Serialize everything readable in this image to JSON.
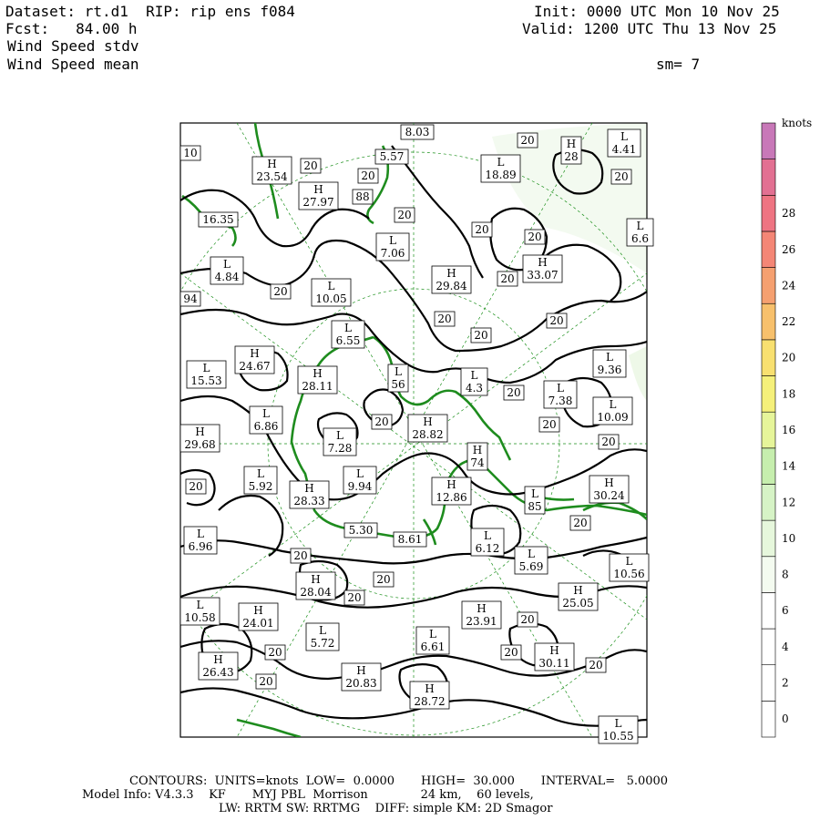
{
  "header": {
    "dataset": "Dataset: rt.d1  RIP: rip ens f084",
    "fcst": "Fcst:   84.00 h",
    "field_stdv": "Wind Speed stdv",
    "field_mean": "Wind Speed mean",
    "init": "Init: 0000 UTC Mon 10 Nov 25",
    "valid": "Valid: 1200 UTC Thu 13 Nov 25",
    "smooth": "sm= 7"
  },
  "colorbar": {
    "units": "knots",
    "labels": [
      "0",
      "2",
      "4",
      "6",
      "8",
      "10",
      "12",
      "14",
      "16",
      "18",
      "20",
      "22",
      "24",
      "26",
      "28"
    ],
    "colors": [
      "#ffffff",
      "#ffffff",
      "#ffffff",
      "#ffffff",
      "#f4fbf0",
      "#e6f7dc",
      "#d6f3c6",
      "#c6eeae",
      "#e6f59a",
      "#f5f07a",
      "#f8e070",
      "#f7c06c",
      "#f5a070",
      "#f48676",
      "#ee7482",
      "#e27092",
      "#c878b8"
    ]
  },
  "labels": [
    {
      "kind": "L",
      "value": "4.41"
    },
    {
      "kind": "H",
      "value": "28"
    },
    {
      "kind": "",
      "value": "20"
    },
    {
      "kind": "",
      "value": "20"
    },
    {
      "kind": "",
      "value": "8.03"
    },
    {
      "kind": "",
      "value": "10"
    },
    {
      "kind": "H",
      "value": "23.54"
    },
    {
      "kind": "",
      "value": "20"
    },
    {
      "kind": "",
      "value": "5.57"
    },
    {
      "kind": "L",
      "value": "18.89"
    },
    {
      "kind": "",
      "value": "20"
    },
    {
      "kind": "H",
      "value": "27.97"
    },
    {
      "kind": "",
      "value": "88"
    },
    {
      "kind": "",
      "value": "20"
    },
    {
      "kind": "",
      "value": "20"
    },
    {
      "kind": "",
      "value": "16.35"
    },
    {
      "kind": "L",
      "value": "7.06"
    },
    {
      "kind": "",
      "value": "20"
    },
    {
      "kind": "",
      "value": "20"
    },
    {
      "kind": "L",
      "value": "6.6"
    },
    {
      "kind": "L",
      "value": "4.84"
    },
    {
      "kind": "H",
      "value": "29.84"
    },
    {
      "kind": "H",
      "value": "33.07"
    },
    {
      "kind": "",
      "value": "94"
    },
    {
      "kind": "",
      "value": "20"
    },
    {
      "kind": "L",
      "value": "10.05"
    },
    {
      "kind": "",
      "value": "20"
    },
    {
      "kind": "",
      "value": "20"
    },
    {
      "kind": "L",
      "value": "6.55"
    },
    {
      "kind": "",
      "value": "20"
    },
    {
      "kind": "",
      "value": "20"
    },
    {
      "kind": "H",
      "value": "24.67"
    },
    {
      "kind": "L",
      "value": "9.36"
    },
    {
      "kind": "L",
      "value": "15.53"
    },
    {
      "kind": "H",
      "value": "28.11"
    },
    {
      "kind": "L",
      "value": "56"
    },
    {
      "kind": "L",
      "value": "4.3"
    },
    {
      "kind": "",
      "value": "20"
    },
    {
      "kind": "L",
      "value": "7.38"
    },
    {
      "kind": "L",
      "value": "6.86"
    },
    {
      "kind": "L",
      "value": "10.09"
    },
    {
      "kind": "",
      "value": "20"
    },
    {
      "kind": "H",
      "value": "28.82"
    },
    {
      "kind": "",
      "value": "20"
    },
    {
      "kind": "H",
      "value": "29.68"
    },
    {
      "kind": "L",
      "value": "7.28"
    },
    {
      "kind": "",
      "value": "20"
    },
    {
      "kind": "H",
      "value": "74"
    },
    {
      "kind": "L",
      "value": "5.92"
    },
    {
      "kind": "L",
      "value": "9.94"
    },
    {
      "kind": "",
      "value": "20"
    },
    {
      "kind": "H",
      "value": "28.33"
    },
    {
      "kind": "H",
      "value": "12.86"
    },
    {
      "kind": "L",
      "value": "85"
    },
    {
      "kind": "H",
      "value": "30.24"
    },
    {
      "kind": "L",
      "value": "6.96"
    },
    {
      "kind": "",
      "value": "20"
    },
    {
      "kind": "",
      "value": "5.30"
    },
    {
      "kind": "",
      "value": "8.61"
    },
    {
      "kind": "L",
      "value": "6.12"
    },
    {
      "kind": "L",
      "value": "5.69"
    },
    {
      "kind": "",
      "value": "20"
    },
    {
      "kind": "L",
      "value": "10.56"
    },
    {
      "kind": "H",
      "value": "28.04"
    },
    {
      "kind": "",
      "value": "20"
    },
    {
      "kind": "",
      "value": "20"
    },
    {
      "kind": "H",
      "value": "25.05"
    },
    {
      "kind": "L",
      "value": "10.58"
    },
    {
      "kind": "H",
      "value": "24.01"
    },
    {
      "kind": "H",
      "value": "23.91"
    },
    {
      "kind": "L",
      "value": "5.72"
    },
    {
      "kind": "",
      "value": "20"
    },
    {
      "kind": "L",
      "value": "6.61"
    },
    {
      "kind": "",
      "value": "20"
    },
    {
      "kind": "",
      "value": "20"
    },
    {
      "kind": "H",
      "value": "30.11"
    },
    {
      "kind": "",
      "value": "20"
    },
    {
      "kind": "H",
      "value": "26.43"
    },
    {
      "kind": "H",
      "value": "20.83"
    },
    {
      "kind": "",
      "value": "20"
    },
    {
      "kind": "H",
      "value": "28.72"
    },
    {
      "kind": "L",
      "value": "10.55"
    }
  ],
  "footer": {
    "line1": "CONTOURS:  UNITS=knots  LOW=  0.0000       HIGH=  30.000       INTERVAL=   5.0000",
    "line2": "Model Info: V4.3.3    KF       MYJ PBL  Morrison              24 km,    60 levels,",
    "line3": "LW: RRTM SW: RRTMG    DIFF: simple KM: 2D Smagor"
  }
}
